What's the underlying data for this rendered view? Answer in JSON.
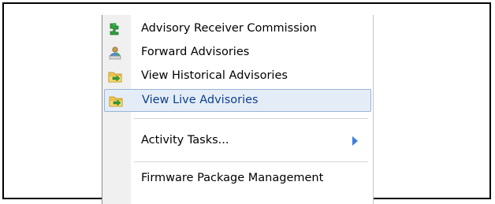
{
  "menu": {
    "items": [
      {
        "label": "Advisory Receiver Commission",
        "icon": "puzzle-piece-icon"
      },
      {
        "label": "Forward Advisories",
        "icon": "forward-user-icon"
      },
      {
        "label": "View Historical Advisories",
        "icon": "folder-arrow-icon"
      },
      {
        "label": "View Live Advisories",
        "icon": "folder-arrow-icon",
        "highlighted": true
      },
      {
        "label": "Activity Tasks...",
        "icon": "submenu-arrow-icon",
        "has_submenu": true
      },
      {
        "label": "Firmware Package Management"
      }
    ]
  },
  "colors": {
    "highlight_bg": "#e4edf7",
    "highlight_border": "#99b4d6",
    "submenu_arrow": "#3d7fe0"
  }
}
